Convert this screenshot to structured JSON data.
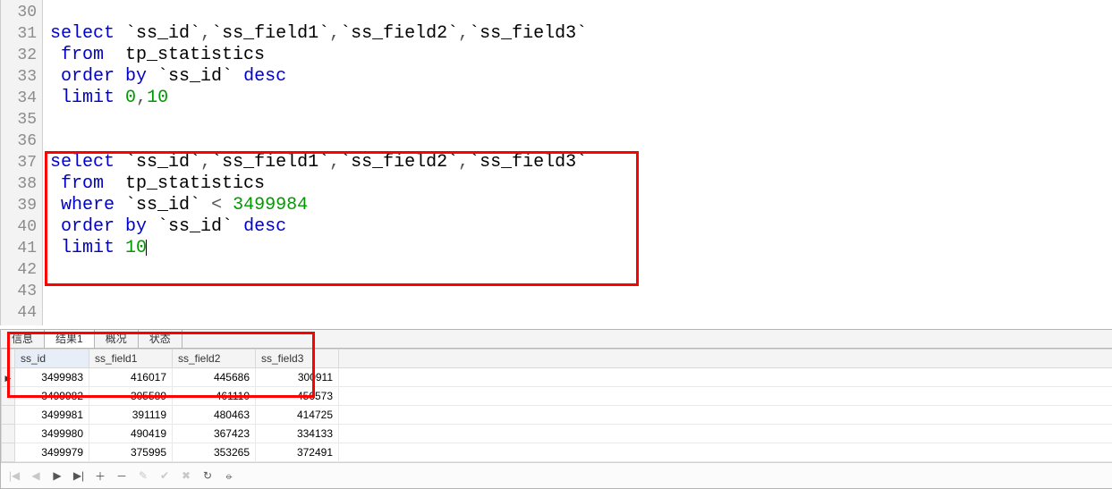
{
  "editor": {
    "lines": [
      {
        "n": 30,
        "tokens": []
      },
      {
        "n": 31,
        "tokens": [
          {
            "t": "select",
            "c": "kw"
          },
          {
            "t": " ",
            "c": "ident"
          },
          {
            "t": "`ss_id`",
            "c": "ident"
          },
          {
            "t": ",",
            "c": "op"
          },
          {
            "t": "`ss_field1`",
            "c": "ident"
          },
          {
            "t": ",",
            "c": "op"
          },
          {
            "t": "`ss_field2`",
            "c": "ident"
          },
          {
            "t": ",",
            "c": "op"
          },
          {
            "t": "`ss_field3`",
            "c": "ident"
          }
        ]
      },
      {
        "n": 32,
        "tokens": [
          {
            "t": " ",
            "c": "ident"
          },
          {
            "t": "from",
            "c": "kw"
          },
          {
            "t": "  tp_statistics",
            "c": "ident"
          }
        ]
      },
      {
        "n": 33,
        "tokens": [
          {
            "t": " ",
            "c": "ident"
          },
          {
            "t": "order by",
            "c": "kw"
          },
          {
            "t": " `ss_id` ",
            "c": "ident"
          },
          {
            "t": "desc",
            "c": "kw"
          }
        ]
      },
      {
        "n": 34,
        "tokens": [
          {
            "t": " ",
            "c": "ident"
          },
          {
            "t": "limit",
            "c": "kw"
          },
          {
            "t": " ",
            "c": "ident"
          },
          {
            "t": "0",
            "c": "num"
          },
          {
            "t": ",",
            "c": "op"
          },
          {
            "t": "10",
            "c": "num"
          }
        ]
      },
      {
        "n": 35,
        "tokens": []
      },
      {
        "n": 36,
        "tokens": []
      },
      {
        "n": 37,
        "tokens": [
          {
            "t": "select",
            "c": "kw"
          },
          {
            "t": " ",
            "c": "ident"
          },
          {
            "t": "`ss_id`",
            "c": "ident"
          },
          {
            "t": ",",
            "c": "op"
          },
          {
            "t": "`ss_field1`",
            "c": "ident"
          },
          {
            "t": ",",
            "c": "op"
          },
          {
            "t": "`ss_field2`",
            "c": "ident"
          },
          {
            "t": ",",
            "c": "op"
          },
          {
            "t": "`ss_field3`",
            "c": "ident"
          }
        ]
      },
      {
        "n": 38,
        "tokens": [
          {
            "t": " ",
            "c": "ident"
          },
          {
            "t": "from",
            "c": "kw"
          },
          {
            "t": "  tp_statistics",
            "c": "ident"
          }
        ]
      },
      {
        "n": 39,
        "tokens": [
          {
            "t": " ",
            "c": "ident"
          },
          {
            "t": "where",
            "c": "kw"
          },
          {
            "t": " `ss_id` ",
            "c": "ident"
          },
          {
            "t": "<",
            "c": "op"
          },
          {
            "t": " ",
            "c": "ident"
          },
          {
            "t": "3499984",
            "c": "num"
          }
        ]
      },
      {
        "n": 40,
        "tokens": [
          {
            "t": " ",
            "c": "ident"
          },
          {
            "t": "order by",
            "c": "kw"
          },
          {
            "t": " `ss_id` ",
            "c": "ident"
          },
          {
            "t": "desc",
            "c": "kw"
          }
        ]
      },
      {
        "n": 41,
        "tokens": [
          {
            "t": " ",
            "c": "ident"
          },
          {
            "t": "limit",
            "c": "kw"
          },
          {
            "t": " ",
            "c": "ident"
          },
          {
            "t": "10",
            "c": "num"
          }
        ],
        "cursor": true
      },
      {
        "n": 42,
        "tokens": []
      },
      {
        "n": 43,
        "tokens": []
      },
      {
        "n": 44,
        "tokens": []
      }
    ]
  },
  "panel": {
    "tabs": [
      "信息",
      "结果1",
      "概况",
      "状态"
    ],
    "active_tab": 1,
    "columns": [
      "ss_id",
      "ss_field1",
      "ss_field2",
      "ss_field3"
    ],
    "rows": [
      {
        "current": true,
        "cells": [
          "3499983",
          "416017",
          "445686",
          "300911"
        ]
      },
      {
        "current": false,
        "cells": [
          "3499982",
          "305589",
          "461110",
          "456573"
        ]
      },
      {
        "current": false,
        "cells": [
          "3499981",
          "391119",
          "480463",
          "414725"
        ]
      },
      {
        "current": false,
        "cells": [
          "3499980",
          "490419",
          "367423",
          "334133"
        ]
      },
      {
        "current": false,
        "cells": [
          "3499979",
          "375995",
          "353265",
          "372491"
        ]
      }
    ]
  },
  "toolbar": {
    "icons": [
      {
        "name": "first-icon",
        "glyph": "|◀",
        "disabled": true
      },
      {
        "name": "prev-icon",
        "glyph": "◀",
        "disabled": true
      },
      {
        "name": "next-icon",
        "glyph": "▶",
        "disabled": false
      },
      {
        "name": "last-icon",
        "glyph": "▶|",
        "disabled": false
      },
      {
        "name": "add-icon",
        "glyph": "＋",
        "disabled": false
      },
      {
        "name": "remove-icon",
        "glyph": "－",
        "disabled": false
      },
      {
        "name": "edit-icon",
        "glyph": "✎",
        "disabled": true
      },
      {
        "name": "confirm-icon",
        "glyph": "✔",
        "disabled": true
      },
      {
        "name": "cancel-icon",
        "glyph": "✖",
        "disabled": true
      },
      {
        "name": "refresh-icon",
        "glyph": "↻",
        "disabled": false
      },
      {
        "name": "stop-icon",
        "glyph": "⦵",
        "disabled": false
      }
    ]
  }
}
